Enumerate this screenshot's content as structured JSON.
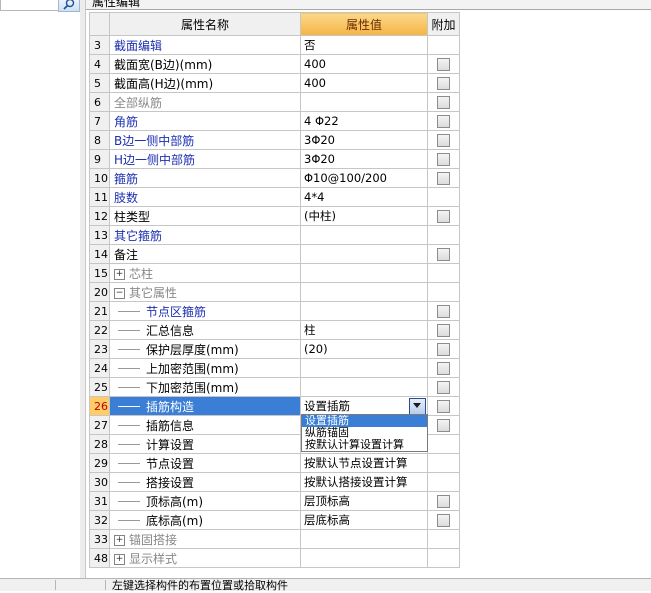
{
  "panel_tab": "属性编辑",
  "columns": {
    "name": "属性名称",
    "value": "属性值",
    "extra": "附加"
  },
  "rows": [
    {
      "num": "3",
      "name": "截面编辑",
      "value": "否",
      "style": "blue",
      "check": false,
      "expander": "",
      "tree": false
    },
    {
      "num": "4",
      "name": "截面宽(B边)(mm)",
      "value": "400",
      "style": "black",
      "check": true,
      "expander": "",
      "tree": false
    },
    {
      "num": "5",
      "name": "截面高(H边)(mm)",
      "value": "400",
      "style": "black",
      "check": true,
      "expander": "",
      "tree": false
    },
    {
      "num": "6",
      "name": "全部纵筋",
      "value": "",
      "style": "gray",
      "check": true,
      "expander": "",
      "tree": false
    },
    {
      "num": "7",
      "name": "角筋",
      "value": "4 Φ22",
      "style": "blue",
      "check": true,
      "expander": "",
      "tree": false
    },
    {
      "num": "8",
      "name": "B边一侧中部筋",
      "value": "3Φ20",
      "style": "blue",
      "check": true,
      "expander": "",
      "tree": false
    },
    {
      "num": "9",
      "name": "H边一侧中部筋",
      "value": "3Φ20",
      "style": "blue",
      "check": true,
      "expander": "",
      "tree": false
    },
    {
      "num": "10",
      "name": "箍筋",
      "value": "Φ10@100/200",
      "style": "blue",
      "check": true,
      "expander": "",
      "tree": false
    },
    {
      "num": "11",
      "name": "肢数",
      "value": "4*4",
      "style": "blue",
      "check": false,
      "expander": "",
      "tree": false
    },
    {
      "num": "12",
      "name": "柱类型",
      "value": "(中柱)",
      "style": "black",
      "check": true,
      "expander": "",
      "tree": false
    },
    {
      "num": "13",
      "name": "其它箍筋",
      "value": "",
      "style": "blue",
      "check": false,
      "expander": "",
      "tree": false
    },
    {
      "num": "14",
      "name": "备注",
      "value": "",
      "style": "black",
      "check": true,
      "expander": "",
      "tree": false
    },
    {
      "num": "15",
      "name": "芯柱",
      "value": "",
      "style": "gray",
      "check": false,
      "expander": "+",
      "tree": false
    },
    {
      "num": "20",
      "name": "其它属性",
      "value": "",
      "style": "gray",
      "check": false,
      "expander": "−",
      "tree": false
    },
    {
      "num": "21",
      "name": "节点区箍筋",
      "value": "",
      "style": "blue",
      "check": true,
      "expander": "",
      "tree": true
    },
    {
      "num": "22",
      "name": "汇总信息",
      "value": "柱",
      "style": "black",
      "check": true,
      "expander": "",
      "tree": true
    },
    {
      "num": "23",
      "name": "保护层厚度(mm)",
      "value": "(20)",
      "style": "black",
      "check": true,
      "expander": "",
      "tree": true
    },
    {
      "num": "24",
      "name": "上加密范围(mm)",
      "value": "",
      "style": "black",
      "check": true,
      "expander": "",
      "tree": true
    },
    {
      "num": "25",
      "name": "下加密范围(mm)",
      "value": "",
      "style": "black",
      "check": true,
      "expander": "",
      "tree": true
    },
    {
      "num": "26",
      "name": "插筋构造",
      "value": "设置插筋",
      "style": "black",
      "check": true,
      "expander": "",
      "tree": true,
      "selected": true
    },
    {
      "num": "27",
      "name": "插筋信息",
      "value": "",
      "style": "black",
      "check": true,
      "expander": "",
      "tree": true
    },
    {
      "num": "28",
      "name": "计算设置",
      "value": "",
      "style": "black",
      "check": false,
      "expander": "",
      "tree": true
    },
    {
      "num": "29",
      "name": "节点设置",
      "value": "按默认节点设置计算",
      "style": "black",
      "check": false,
      "expander": "",
      "tree": true
    },
    {
      "num": "30",
      "name": "搭接设置",
      "value": "按默认搭接设置计算",
      "style": "black",
      "check": false,
      "expander": "",
      "tree": true
    },
    {
      "num": "31",
      "name": "顶标高(m)",
      "value": "层顶标高",
      "style": "black",
      "check": true,
      "expander": "",
      "tree": true
    },
    {
      "num": "32",
      "name": "底标高(m)",
      "value": "层底标高",
      "style": "black",
      "check": true,
      "expander": "",
      "tree": true
    },
    {
      "num": "33",
      "name": "锚固搭接",
      "value": "",
      "style": "gray",
      "check": false,
      "expander": "+",
      "tree": false
    },
    {
      "num": "48",
      "name": "显示样式",
      "value": "",
      "style": "gray",
      "check": false,
      "expander": "+",
      "tree": false
    }
  ],
  "dropdown": {
    "options": [
      "设置插筋",
      "纵筋锚固",
      "按默认计算设置计算"
    ],
    "selected_index": 0
  },
  "status_text": "左键选择构件的布置位置或拾取构件",
  "colors": {
    "selection": "#3a7fd5",
    "header_value": "#f5b445",
    "link_blue": "#1c2fb0"
  }
}
